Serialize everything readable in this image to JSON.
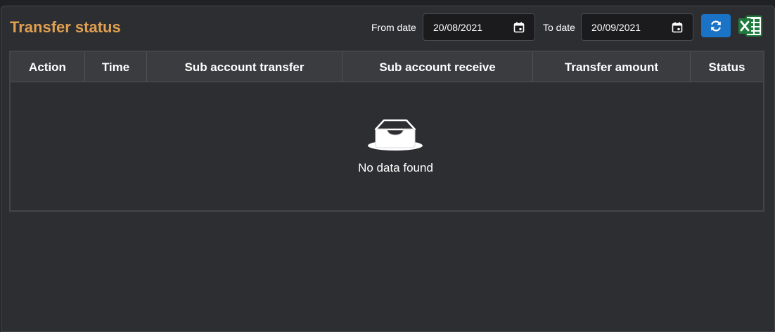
{
  "header": {
    "title": "Transfer status",
    "from_date_label": "From date",
    "from_date_value": "20/08/2021",
    "to_date_label": "To date",
    "to_date_value": "20/09/2021",
    "refresh_icon": "refresh-icon",
    "excel_icon": "excel-export-icon"
  },
  "table": {
    "columns": [
      "Action",
      "Time",
      "Sub account transfer",
      "Sub account receive",
      "Transfer amount",
      "Status"
    ],
    "empty_message": "No data found",
    "empty_icon": "empty-inbox-icon"
  },
  "colors": {
    "title": "#e0a050",
    "panel_bg": "#2d2e32",
    "header_bg": "#3b3c40",
    "refresh_button": "#1a73c6",
    "excel_green": "#1f7a3c"
  }
}
